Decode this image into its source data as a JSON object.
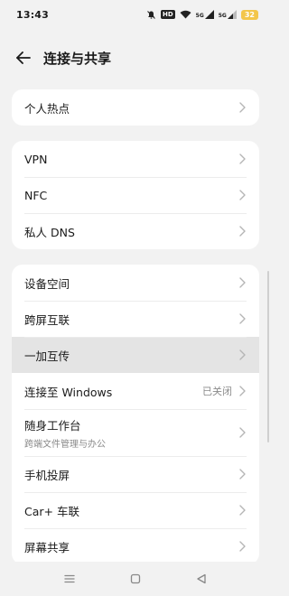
{
  "status": {
    "time": "13:43",
    "hd_label": "HD",
    "signal1_label": "5G",
    "signal2_label": "5G",
    "battery": "32"
  },
  "header": {
    "title": "连接与共享"
  },
  "groups": [
    {
      "items": [
        {
          "label": "个人热点"
        }
      ]
    },
    {
      "items": [
        {
          "label": "VPN"
        },
        {
          "label": "NFC"
        },
        {
          "label": "私人 DNS"
        }
      ]
    },
    {
      "items": [
        {
          "label": "设备空间"
        },
        {
          "label": "跨屏互联"
        },
        {
          "label": "一加互传"
        },
        {
          "label": "连接至 Windows",
          "value": "已关闭"
        },
        {
          "label": "随身工作台",
          "subtitle": "跨端文件管理与办公"
        },
        {
          "label": "手机投屏"
        },
        {
          "label": "Car+ 车联"
        },
        {
          "label": "屏幕共享"
        }
      ]
    }
  ],
  "icons": {
    "back": "arrow-left-icon",
    "chevron": "chevron-right-icon",
    "nav_menu": "menu-icon",
    "nav_home": "home-square-icon",
    "nav_back": "triangle-back-icon"
  },
  "colors": {
    "background": "#f2f2f2",
    "card": "#ffffff",
    "highlight": "#e4e4e4",
    "battery": "#f3c64a"
  }
}
